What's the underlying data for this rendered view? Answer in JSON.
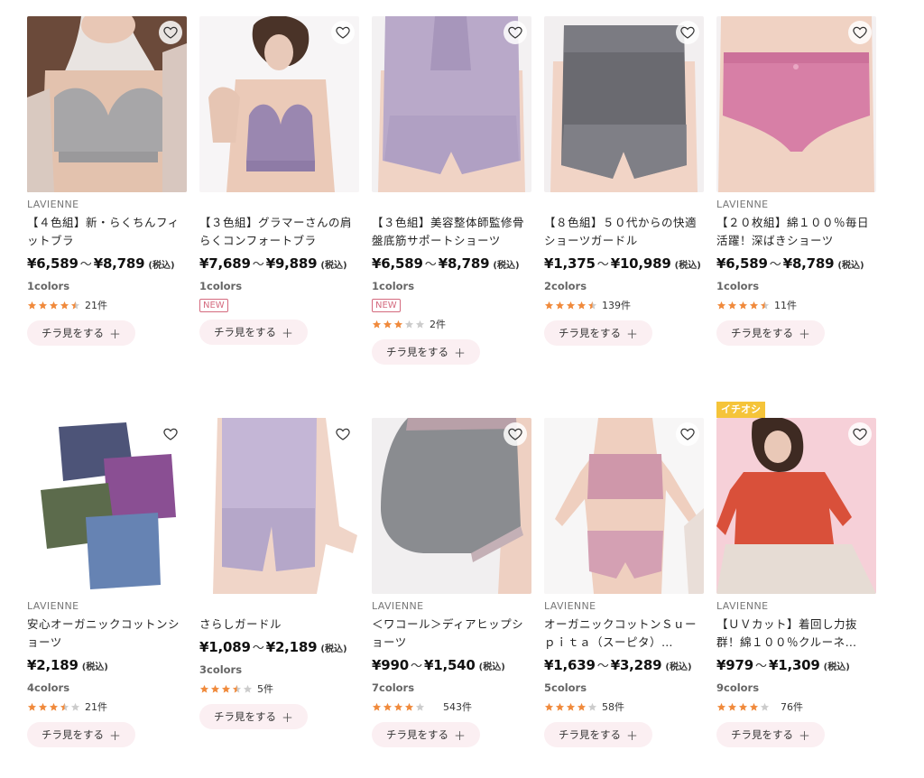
{
  "labels": {
    "peek": "チラ見をする",
    "plus": "＋",
    "tilde": "～",
    "tax": "(税込)",
    "new": "NEW",
    "pick": "イチオシ"
  },
  "products": [
    {
      "brand": "LAVIENNE",
      "name": "【４色組】新・らくちんフィットブラ",
      "price_min": "¥6,589",
      "price_max": "¥8,789",
      "colors": "1colors",
      "rating": 4.5,
      "reviews": "21件",
      "image": "gray-lace-bra-model"
    },
    {
      "brand": "",
      "name": "【３色組】グラマーさんの肩らくコンフォートブラ",
      "price_min": "¥7,689",
      "price_max": "¥9,889",
      "colors": "1colors",
      "badge": "NEW",
      "image": "lavender-bra-model"
    },
    {
      "brand": "",
      "name": "【３色組】美容整体師監修骨盤底筋サポートショーツ",
      "price_min": "¥6,589",
      "price_max": "¥8,789",
      "colors": "1colors",
      "badge": "NEW",
      "rating": 3,
      "reviews": "2件",
      "image": "lavender-support-shorts"
    },
    {
      "brand": "",
      "name": "【８色組】５０代からの快適ショーツガードル",
      "price_min": "¥1,375",
      "price_max": "¥10,989",
      "colors": "2colors",
      "rating": 4.5,
      "reviews": "139件",
      "image": "gray-lace-girdle"
    },
    {
      "brand": "LAVIENNE",
      "name": "【２０枚組】綿１００％毎日活躍！深ばきショーツ",
      "price_min": "¥6,589",
      "price_max": "¥8,789",
      "colors": "1colors",
      "rating": 4.5,
      "reviews": "11件",
      "image": "pink-cotton-shorts"
    },
    {
      "brand": "LAVIENNE",
      "name": "安心オーガニックコットンショーツ",
      "price_min": "¥2,189",
      "price_max": "",
      "colors": "4colors",
      "rating": 3.5,
      "reviews": "21件",
      "image": "organic-cotton-shorts-stack"
    },
    {
      "brand": "",
      "name": "さらしガードル",
      "price_min": "¥1,089",
      "price_max": "¥2,189",
      "colors": "3colors",
      "rating": 3.5,
      "reviews": "5件",
      "image": "lavender-long-girdle"
    },
    {
      "brand": "LAVIENNE",
      "name": "＜ワコール＞ディアヒップショーツ",
      "price_min": "¥990",
      "price_max": "¥1,540",
      "colors": "7colors",
      "rating": 4,
      "reviews": "543件",
      "image": "gray-hip-shorts"
    },
    {
      "brand": "LAVIENNE",
      "name": "オーガニックコットンＳｕーｐｉｔａ（スーピタ）…",
      "price_min": "¥1,639",
      "price_max": "¥3,289",
      "colors": "5colors",
      "rating": 4,
      "reviews": "58件",
      "image": "pink-bra-set-model"
    },
    {
      "brand": "LAVIENNE",
      "name": "【ＵＶカット】着回し力抜群！綿１００％クルーネ…",
      "price_min": "¥979",
      "price_max": "¥1,309",
      "colors": "9colors",
      "rating": 4,
      "reviews": "76件",
      "badge_pick": "イチオシ",
      "image": "red-crewneck-model"
    }
  ],
  "colors": {
    "star": "#f08a3c",
    "star_empty": "#cccccc",
    "new_badge": "#d46a7e",
    "peek_bg": "#fbeff2",
    "pick_badge": "#f5c43a"
  }
}
